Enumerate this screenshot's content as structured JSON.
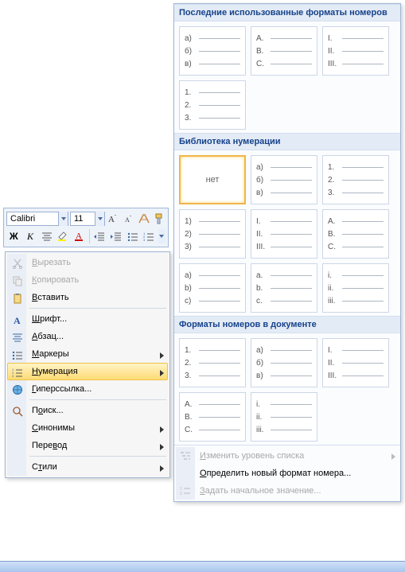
{
  "toolbar": {
    "font_name": "Calibri",
    "font_size": "11"
  },
  "context_menu": {
    "cut": "Вырезать",
    "copy": "Копировать",
    "paste": "Вставить",
    "font": "Шрифт...",
    "paragraph": "Абзац...",
    "bullets": "Маркеры",
    "numbering": "Нумерация",
    "hyperlink": "Гиперссылка...",
    "search": "Поиск...",
    "synonyms": "Синонимы",
    "translate": "Перевод",
    "styles": "Стили"
  },
  "panel": {
    "section_recent": "Последние использованные форматы номеров",
    "section_library": "Библиотека нумерации",
    "section_document": "Форматы номеров в документе",
    "none_label": "нет",
    "recent_tiles": [
      [
        "а)",
        "б)",
        "в)"
      ],
      [
        "A.",
        "B.",
        "C."
      ],
      [
        "I.",
        "II.",
        "III."
      ],
      [
        "1.",
        "2.",
        "3."
      ]
    ],
    "library_tiles": [
      null,
      [
        "а)",
        "б)",
        "в)"
      ],
      [
        "1.",
        "2.",
        "3."
      ],
      [
        "1)",
        "2)",
        "3)"
      ],
      [
        "I.",
        "II.",
        "III."
      ],
      [
        "A.",
        "B.",
        "C."
      ],
      [
        "a)",
        "b)",
        "c)"
      ],
      [
        "a.",
        "b.",
        "c."
      ],
      [
        "i.",
        "ii.",
        "iii."
      ]
    ],
    "document_tiles": [
      [
        "1.",
        "2.",
        "3."
      ],
      [
        "а)",
        "б)",
        "в)"
      ],
      [
        "I.",
        "II.",
        "III."
      ],
      [
        "A.",
        "B.",
        "C."
      ],
      [
        "i.",
        "ii.",
        "iii."
      ]
    ],
    "footer": {
      "change_level": "Изменить уровень списка",
      "define_new": "Определить новый формат номера...",
      "set_value": "Задать начальное значение..."
    }
  }
}
